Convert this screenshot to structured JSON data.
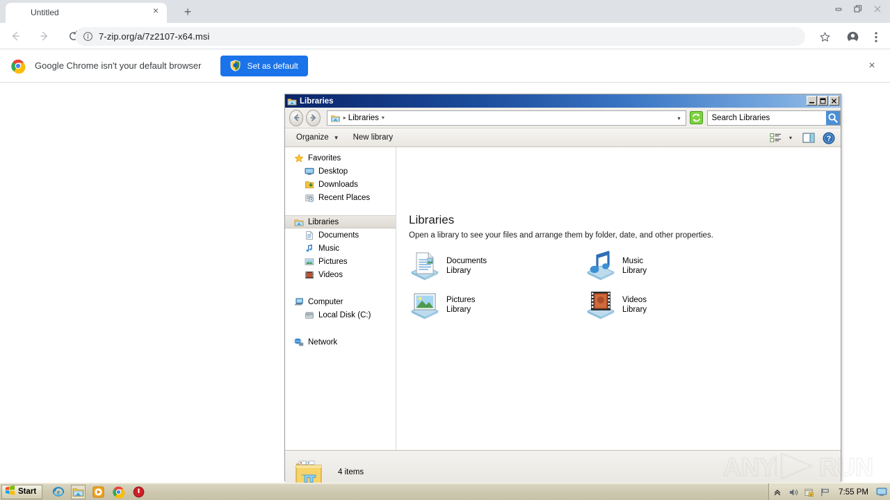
{
  "browser": {
    "tab": {
      "title": "Untitled",
      "close_label": "×"
    },
    "new_tab_label": "+",
    "window_controls": {
      "minimize": "minimize-icon",
      "restore": "restore-icon",
      "close": "close-icon"
    },
    "nav": {
      "back": "back-arrow-icon",
      "forward": "forward-arrow-icon",
      "reload": "reload-icon"
    },
    "omnibox": {
      "url": "7-zip.org/a/7z2107-x64.msi",
      "info_icon": "info-circle-icon"
    },
    "toolbar_icons": {
      "bookmark": "star-icon",
      "profile": "account-circle-icon",
      "menu": "three-dot-menu-icon"
    },
    "infobar": {
      "message": "Google Chrome isn't your default browser",
      "button_label": "Set as default",
      "close_label": "×",
      "accent": "#1a73e8"
    }
  },
  "explorer": {
    "title": "Libraries",
    "window_buttons": {
      "minimize": "_",
      "maximize": "□",
      "close": "×"
    },
    "address": {
      "back": "back-circle-icon",
      "forward": "forward-circle-icon",
      "crumb": "Libraries",
      "refresh": "refresh-icon",
      "search_placeholder": "Search Libraries",
      "search_icon": "magnifier-icon"
    },
    "command_bar": {
      "organize": "Organize",
      "new_library": "New library",
      "view_icon": "change-view-icon",
      "view_caret": "▾",
      "preview_icon": "preview-pane-icon",
      "help_icon": "help-icon"
    },
    "nav_pane": {
      "groups": [
        {
          "header": {
            "label": "Favorites",
            "icon": "star-icon"
          },
          "items": [
            {
              "label": "Desktop",
              "icon": "desktop-icon"
            },
            {
              "label": "Downloads",
              "icon": "downloads-icon"
            },
            {
              "label": "Recent Places",
              "icon": "recent-places-icon"
            }
          ]
        },
        {
          "header": {
            "label": "Libraries",
            "icon": "libraries-icon",
            "selected": true
          },
          "items": [
            {
              "label": "Documents",
              "icon": "documents-icon"
            },
            {
              "label": "Music",
              "icon": "music-icon"
            },
            {
              "label": "Pictures",
              "icon": "pictures-icon"
            },
            {
              "label": "Videos",
              "icon": "videos-icon"
            }
          ]
        },
        {
          "header": {
            "label": "Computer",
            "icon": "computer-icon"
          },
          "items": [
            {
              "label": "Local Disk (C:)",
              "icon": "hard-drive-icon"
            }
          ]
        },
        {
          "header": {
            "label": "Network",
            "icon": "network-icon"
          },
          "items": []
        }
      ]
    },
    "content": {
      "heading": "Libraries",
      "subheading": "Open a library to see your files and arrange them by folder, date, and other properties.",
      "tiles": [
        {
          "name": "Documents",
          "kind": "Library",
          "icon": "documents-library-icon"
        },
        {
          "name": "Music",
          "kind": "Library",
          "icon": "music-library-icon"
        },
        {
          "name": "Pictures",
          "kind": "Library",
          "icon": "pictures-library-icon"
        },
        {
          "name": "Videos",
          "kind": "Library",
          "icon": "videos-library-icon"
        }
      ]
    },
    "status": {
      "text": "4 items",
      "icon": "libraries-folder-icon"
    }
  },
  "watermark": {
    "text": "ANY RUN"
  },
  "taskbar": {
    "start_label": "Start",
    "quick_launch": [
      {
        "name": "internet-explorer-icon"
      },
      {
        "name": "windows-explorer-icon",
        "active": true
      },
      {
        "name": "media-player-icon"
      },
      {
        "name": "google-chrome-icon"
      },
      {
        "name": "red-stop-icon"
      }
    ],
    "tray": {
      "icons": [
        "show-hidden-icons-chevron",
        "volume-icon",
        "action-center-icon",
        "network-flag-icon"
      ],
      "clock": "7:55 PM",
      "show_desktop": "show-desktop-icon"
    }
  }
}
